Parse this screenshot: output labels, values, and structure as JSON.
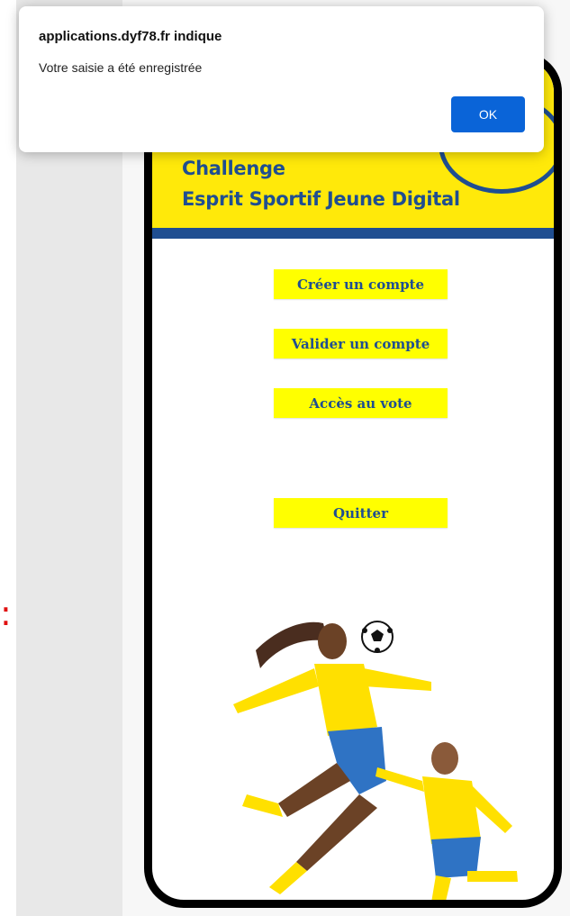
{
  "dialog": {
    "title": "applications.dyf78.fr indique",
    "message": "Votre saisie a été enregistrée",
    "ok_label": "OK"
  },
  "app": {
    "title_line1": "Challenge",
    "title_line2": "Esprit Sportif Jeune Digital",
    "buttons": {
      "create_account": "Créer un compte",
      "validate_account": "Valider un compte",
      "vote_access": "Accès au vote",
      "quit": "Quitter"
    }
  },
  "colors": {
    "brand_yellow": "#ffe90a",
    "button_yellow": "#ffff00",
    "brand_blue": "#1f4e91",
    "dialog_button_blue": "#0a64d8"
  },
  "icons": {
    "logo": "club-logo-icon",
    "illustration": "footballers-illustration"
  }
}
